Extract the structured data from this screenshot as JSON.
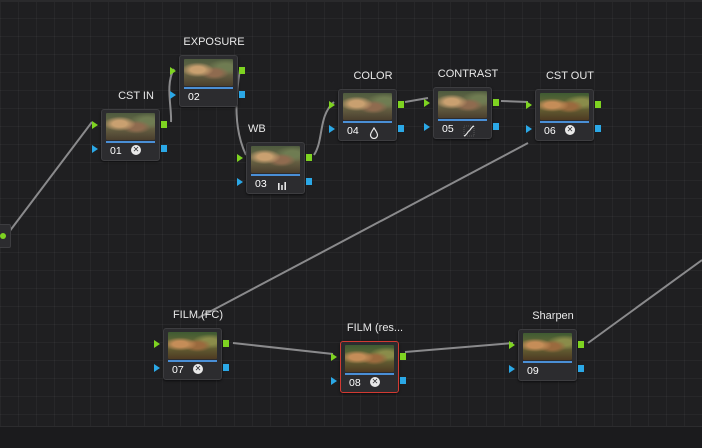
{
  "nodes": [
    {
      "id": "01",
      "title": "CST IN",
      "number": "01",
      "icon": "color-space-transform-icon"
    },
    {
      "id": "02",
      "title": "EXPOSURE",
      "number": "02",
      "icon": ""
    },
    {
      "id": "03",
      "title": "WB",
      "number": "03",
      "icon": "rgb-bars-icon"
    },
    {
      "id": "04",
      "title": "COLOR",
      "number": "04",
      "icon": "drop-icon"
    },
    {
      "id": "05",
      "title": "CONTRAST",
      "number": "05",
      "icon": "curve-icon"
    },
    {
      "id": "06",
      "title": "CST OUT",
      "number": "06",
      "icon": "color-space-transform-icon"
    },
    {
      "id": "07",
      "title": "FILM (FC)",
      "number": "07",
      "icon": "color-space-transform-icon"
    },
    {
      "id": "08",
      "title": "FILM (res...",
      "number": "08",
      "icon": "color-space-transform-icon",
      "selected": true
    },
    {
      "id": "09",
      "title": "Sharpen",
      "number": "09",
      "icon": ""
    }
  ],
  "colors": {
    "rgb_input": "#7ed321",
    "alpha_input": "#2ba8e6",
    "selection_border": "#d23a32",
    "thumbnail_bar": "#4a8fd6",
    "wire": "#8a8a8c"
  }
}
